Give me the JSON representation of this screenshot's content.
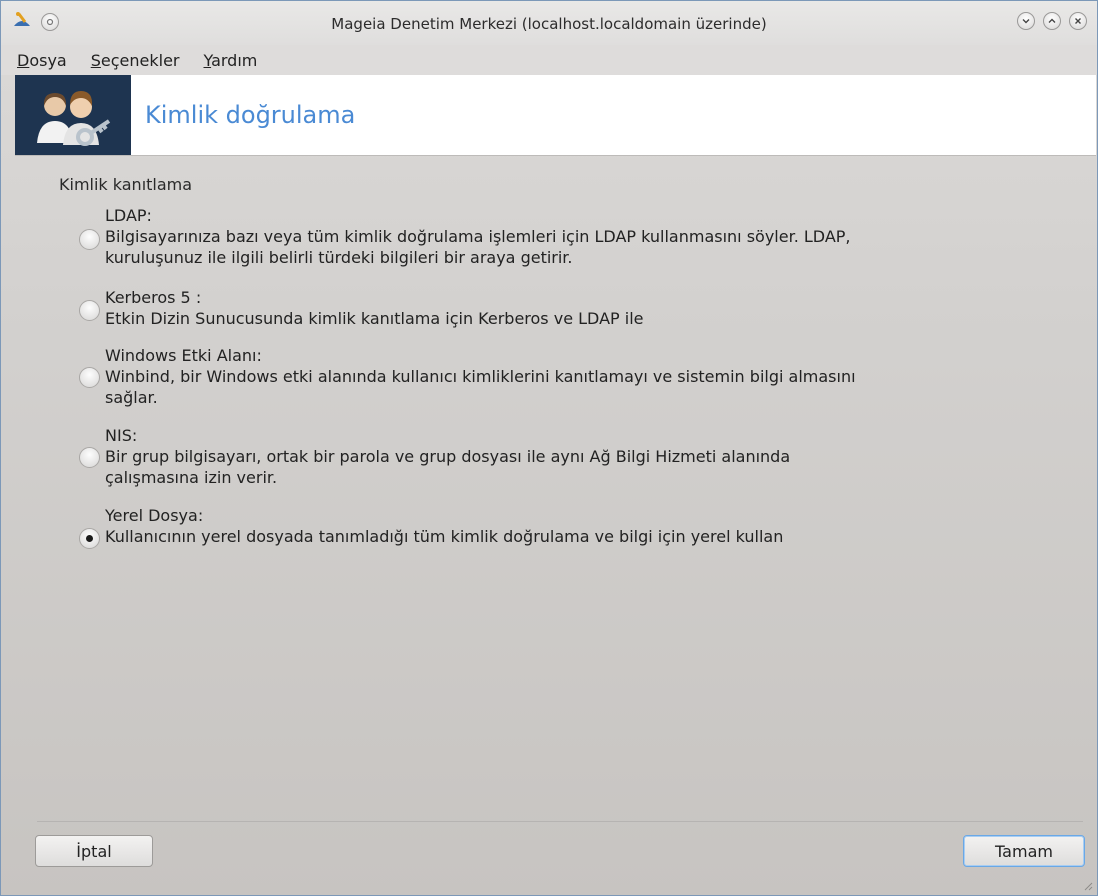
{
  "window": {
    "title": "Mageia Denetim Merkezi  (localhost.localdomain üzerinde)"
  },
  "menu": {
    "items": [
      {
        "accel": "D",
        "rest": "osya"
      },
      {
        "accel": "S",
        "rest": "eçenekler"
      },
      {
        "accel": "Y",
        "rest": "ardım"
      }
    ]
  },
  "banner": {
    "title": "Kimlik doğrulama"
  },
  "section": {
    "label": "Kimlik kanıtlama"
  },
  "options": [
    {
      "name": "LDAP:",
      "desc": "Bilgisayarınıza bazı veya tüm kimlik doğrulama işlemleri için LDAP kullanmasını söyler. LDAP, kuruluşunuz ile ilgili belirli türdeki bilgileri bir araya getirir.",
      "checked": false
    },
    {
      "name": "Kerberos 5 :",
      "desc": "Etkin Dizin Sunucusunda kimlik kanıtlama için Kerberos ve LDAP ile",
      "checked": false
    },
    {
      "name": "Windows Etki Alanı:",
      "desc": "Winbind, bir Windows etki alanında kullanıcı kimliklerini kanıtlamayı ve sistemin bilgi almasını sağlar.",
      "checked": false
    },
    {
      "name": "NIS:",
      "desc": "Bir grup bilgisayarı, ortak bir parola ve grup dosyası ile aynı Ağ Bilgi Hizmeti alanında çalışmasına izin verir.",
      "checked": false
    },
    {
      "name": "Yerel Dosya:",
      "desc": "Kullanıcının yerel dosyada tanımladığı tüm kimlik doğrulama ve bilgi için yerel kullan",
      "checked": true
    }
  ],
  "buttons": {
    "cancel": "İptal",
    "ok": "Tamam"
  }
}
